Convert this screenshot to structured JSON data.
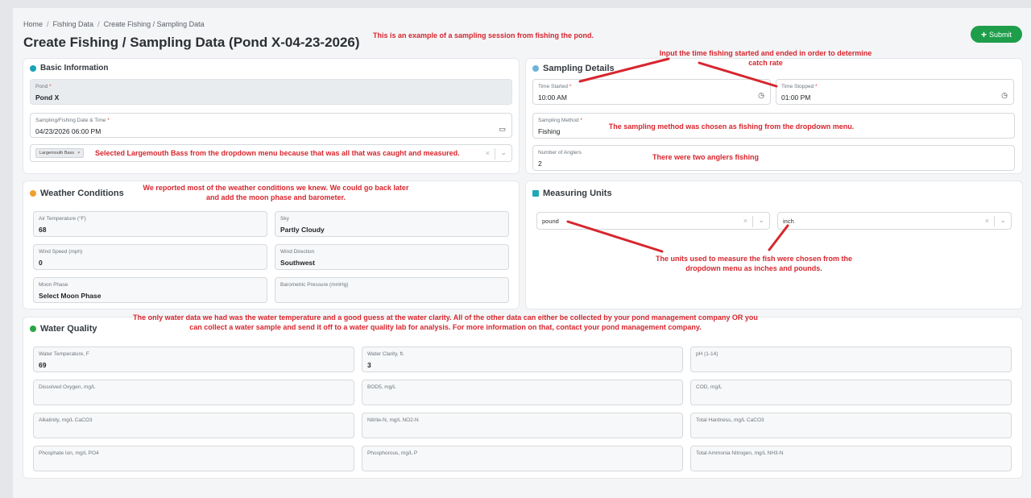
{
  "breadcrumb": [
    "Home",
    "Fishing Data",
    "Create Fishing / Sampling Data"
  ],
  "page_title": "Create Fishing / Sampling Data (Pond X-04-23-2026)",
  "submit_label": "Submit",
  "basic": {
    "title": "Basic Information",
    "pond_label": "Pond",
    "pond_value": "Pond X",
    "date_label": "Sampling/Fishing Date & Time",
    "date_value": "04/23/2026 06:00 PM",
    "species_chip": "Largemouth Bass"
  },
  "sampling": {
    "title": "Sampling Details",
    "time_started_label": "Time Started",
    "time_started_value": "10:00 AM",
    "time_stopped_label": "Time Stopped",
    "time_stopped_value": "01:00 PM",
    "method_label": "Sampling Method",
    "method_value": "Fishing",
    "anglers_label": "Number of Anglers",
    "anglers_value": "2"
  },
  "weather": {
    "title": "Weather Conditions",
    "air_temp_label": "Air Temperature (°F)",
    "air_temp_value": "68",
    "sky_label": "Sky",
    "sky_value": "Partly Cloudy",
    "wind_speed_label": "Wind Speed (mph)",
    "wind_speed_value": "0",
    "wind_dir_label": "Wind Direction",
    "wind_dir_value": "Southwest",
    "moon_label": "Moon Phase",
    "moon_value": "Select Moon Phase",
    "baro_label": "Barometric Pressure (mmHg)"
  },
  "units": {
    "title": "Measuring Units",
    "weight_value": "pound",
    "length_value": "inch"
  },
  "water": {
    "title": "Water Quality",
    "fields": [
      {
        "label": "Water Temperature, F",
        "value": "69"
      },
      {
        "label": "Water Clarity, ft.",
        "value": "3"
      },
      {
        "label": "pH (1-14)",
        "value": ""
      },
      {
        "label": "Dissolved Oxygen, mg/L",
        "value": ""
      },
      {
        "label": "BOD5, mg/L",
        "value": ""
      },
      {
        "label": "COD, mg/L",
        "value": ""
      },
      {
        "label": "Alkalinity, mg/L CaCO3",
        "value": ""
      },
      {
        "label": "Nitrite-N, mg/L NO2-N",
        "value": ""
      },
      {
        "label": "Total Hardness, mg/L CaCO3",
        "value": ""
      },
      {
        "label": "Phosphate Ion, mg/L PO4",
        "value": ""
      },
      {
        "label": "Phosphorous, mg/L P",
        "value": ""
      },
      {
        "label": "Total Ammonia Nitrogen, mg/L NH3-N",
        "value": ""
      }
    ]
  },
  "annotations": {
    "session": "This is an example of a sampling session from fishing the pond.",
    "time": "Input the time fishing started and ended in order to determine catch rate",
    "method": "The sampling method was chosen as fishing from the dropdown menu.",
    "anglers": "There were two anglers fishing",
    "species": "Selected Largemouth Bass from the dropdown menu because that was all that was caught and measured.",
    "weather": "We reported most of the weather conditions we knew. We could go back later and add the moon phase and barometer.",
    "units": "The units used to measure the fish were chosen from the dropdown menu as inches and pounds.",
    "water": "The only water data we had was the water temperature and a good guess at the water clarity. All of the other data can either be collected by your pond management company OR you can collect a water sample and send it off to a water quality lab for analysis. For more information on that, contact your pond management company."
  },
  "colors": {
    "accent": "#1e9e4a",
    "annotation": "#d7262e",
    "required": "#d9342b"
  }
}
